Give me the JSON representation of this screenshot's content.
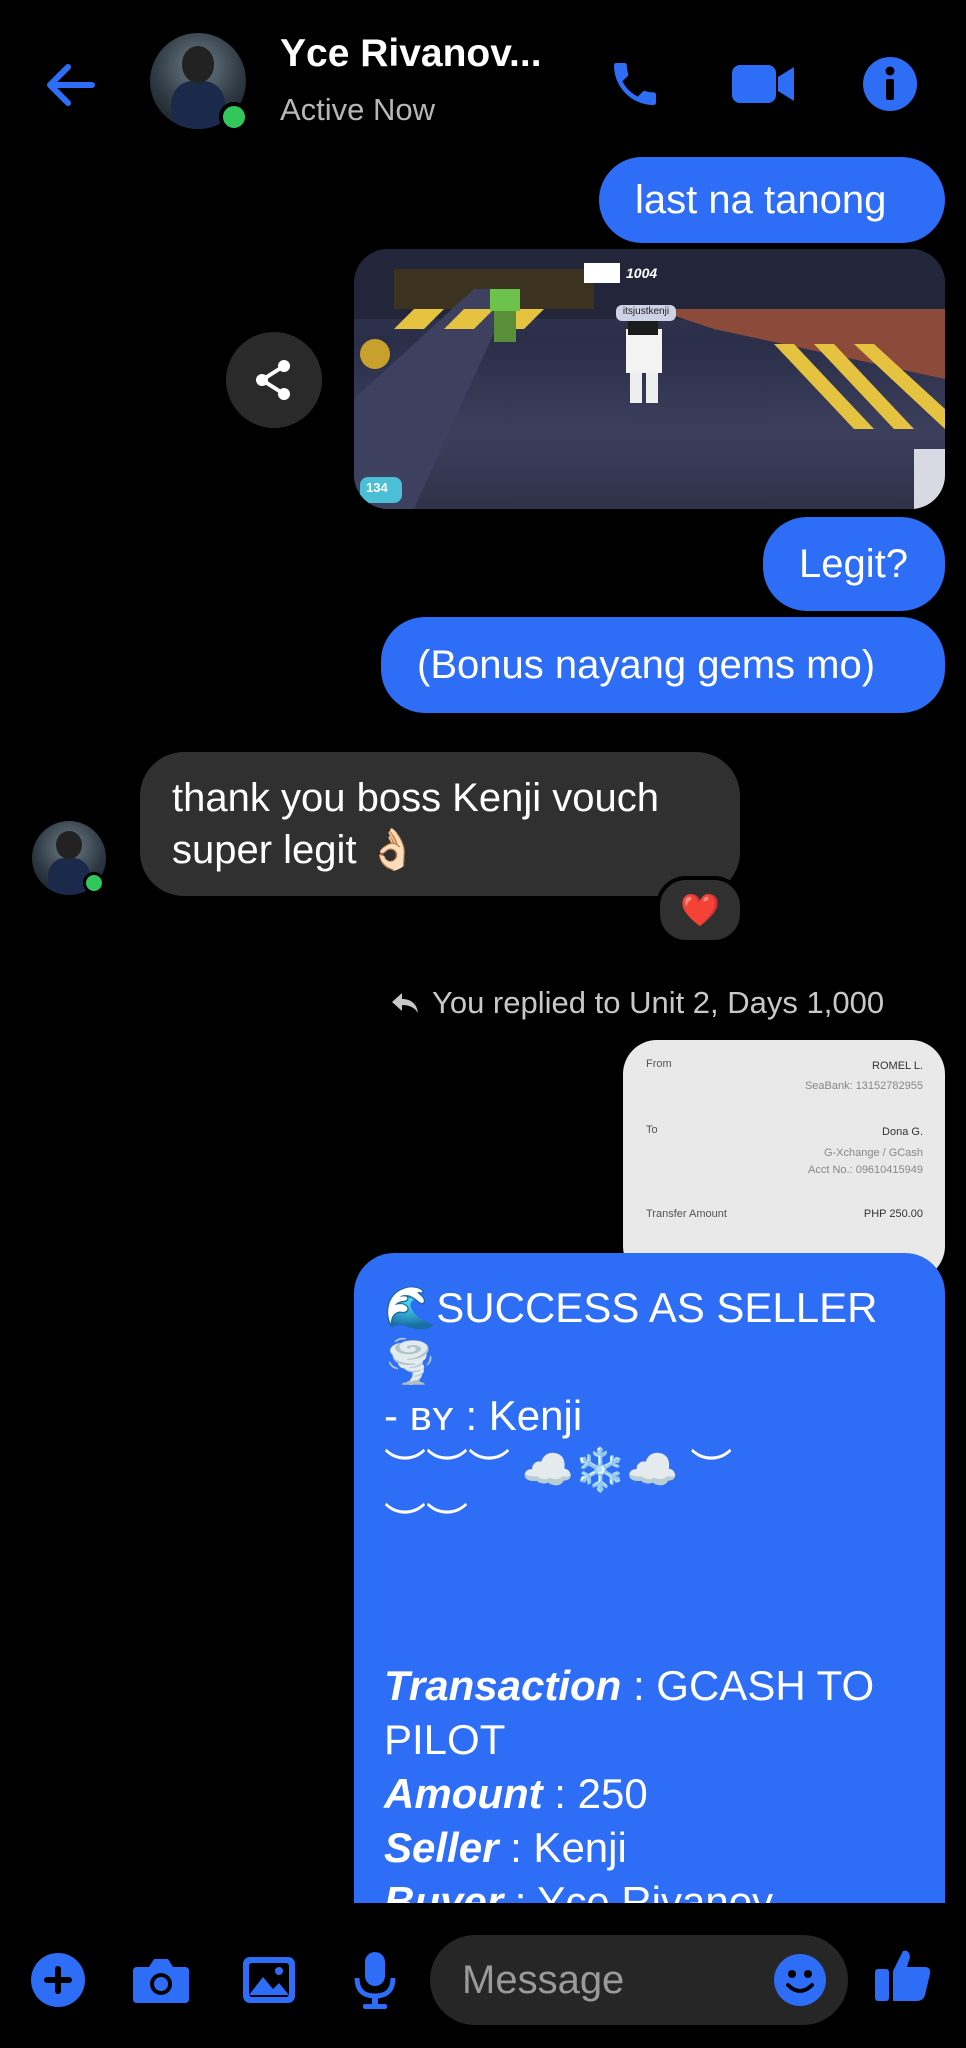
{
  "header": {
    "contact_name": "Yce Rivanov...",
    "status": "Active Now",
    "accent": "#2e6df6"
  },
  "icons": [
    "back-arrow-icon",
    "phone-icon",
    "video-camera-icon",
    "info-icon",
    "share-icon",
    "reply-arrow-icon",
    "plus-icon",
    "camera-icon",
    "gallery-icon",
    "microphone-icon",
    "emoji-icon",
    "thumbs-up-icon"
  ],
  "messages": {
    "m1": "last na tanong",
    "game_screenshot": {
      "hud_counter": "1004",
      "player_tag": "itsjustkenji",
      "gems": "134"
    },
    "m2": "Legit?",
    "m3": "(Bonus nayang gems mo)",
    "m4_line1": "thank you boss Kenji vouch",
    "m4_line2": "super legit 👌🏻",
    "reaction": "❤️"
  },
  "reply": {
    "label": "You replied to Unit 2, Days 1,000",
    "receipt": {
      "from_label": "From",
      "from_name": "ROMEL L.",
      "from_bank": "SeaBank: 13152782955",
      "to_label": "To",
      "to_name": "Dona G.",
      "to_service": "G-Xchange / GCash",
      "to_acct": "Acct No.: 09610415949",
      "amount_label": "Transfer Amount",
      "amount_value": "PHP 250.00"
    }
  },
  "card": {
    "line1": "🌊SUCCESS AS SELLER🌪️",
    "line2": "- ʙʏ : Kenji",
    "line3": "︶︶︶ ☁️❄️☁️ ︶",
    "line4": "︶︶",
    "transaction_label": "Transaction",
    "transaction_value": " : GCASH TO PILOT",
    "amount_label": "Amount",
    "amount_value": " : 250",
    "seller_label": "Seller",
    "seller_value": " : Kenji",
    "buyer_label": "Buyer",
    "buyer_value": " : Yce Rivanov"
  },
  "composer": {
    "placeholder": "Message"
  }
}
